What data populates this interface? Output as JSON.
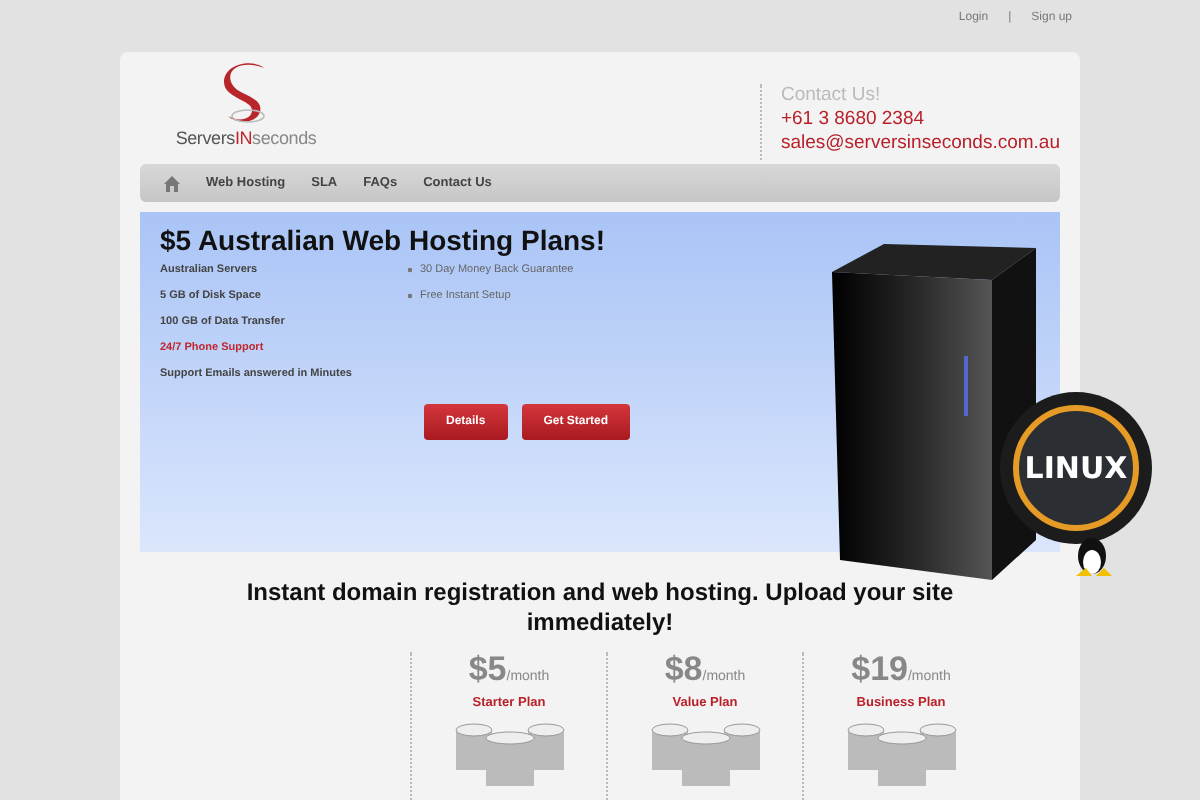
{
  "top_links": [
    "Login",
    "|",
    "Sign up"
  ],
  "logo": {
    "text_left": "Servers",
    "text_mid": "IN",
    "text_right": "seconds"
  },
  "contact": {
    "title": "Contact Us!",
    "phone": "+61 3 8680 2384",
    "email": "sales@serversinseconds.com.au"
  },
  "nav": [
    {
      "label": "Web Hosting"
    },
    {
      "label": "SLA"
    },
    {
      "label": "FAQs"
    },
    {
      "label": "Contact Us"
    }
  ],
  "hero": {
    "title": "$5 Australian Web Hosting Plans!",
    "features": [
      {
        "text": "Australian Servers",
        "highlight": false
      },
      {
        "text": "5 GB of Disk Space",
        "highlight": false
      },
      {
        "text": "100 GB of Data Transfer",
        "highlight": false
      },
      {
        "text": "24/7 Phone Support",
        "highlight": true
      },
      {
        "text": "Support Emails answered in Minutes",
        "highlight": false
      }
    ],
    "bullets": [
      "30 Day Money Back Guarantee",
      "Free Instant Setup"
    ],
    "buttons": [
      "Details",
      "Get Started"
    ],
    "badge": "LINUX"
  },
  "headline": "Instant domain registration and web hosting. Upload your site immediately!",
  "plans": [
    {
      "price": "$5",
      "period": "/month",
      "name": "Starter Plan"
    },
    {
      "price": "$8",
      "period": "/month",
      "name": "Value Plan"
    },
    {
      "price": "$19",
      "period": "/month",
      "name": "Business Plan"
    }
  ]
}
